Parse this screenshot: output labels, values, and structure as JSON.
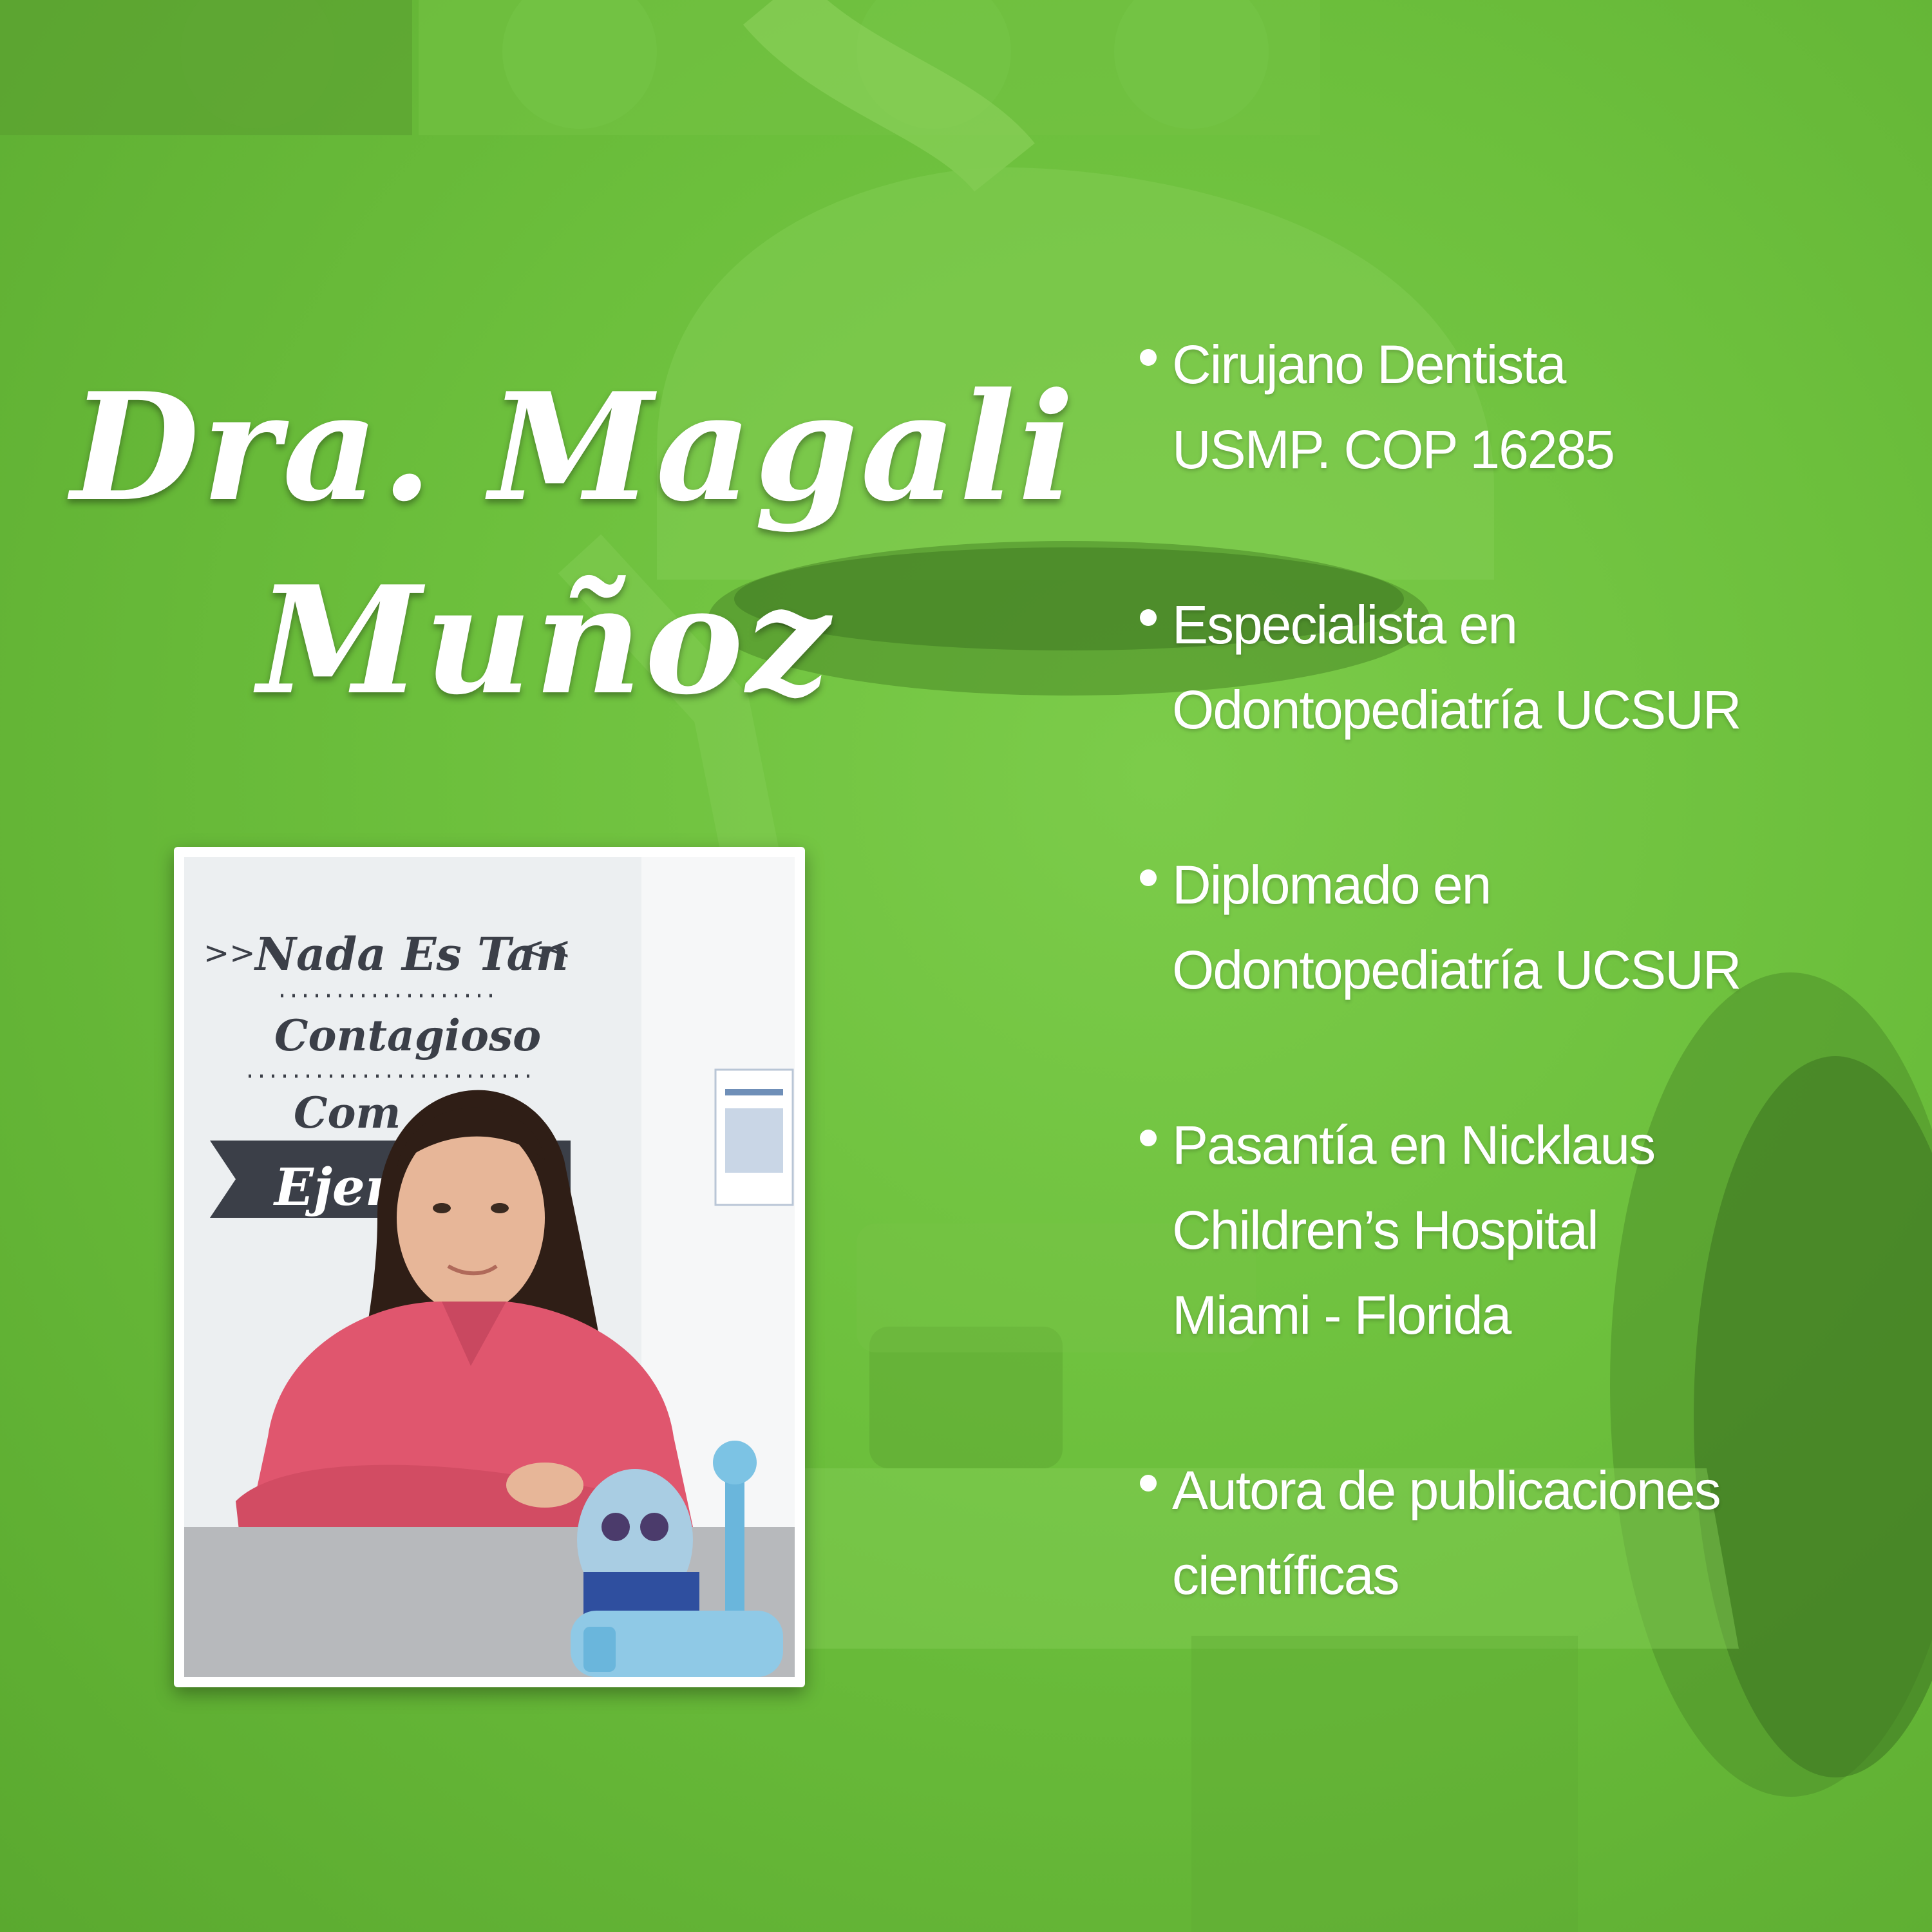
{
  "name": {
    "line1": "Dra. Magali",
    "line2": "Muñoz"
  },
  "photo": {
    "wall_text": {
      "line1": "Nada Es Tan",
      "line2": "Contagioso",
      "line3": "Com",
      "line4": "Ejem"
    }
  },
  "credentials": [
    {
      "lines": [
        "Cirujano Dentista",
        "USMP. COP 16285"
      ]
    },
    {
      "lines": [
        "Especialista en",
        "Odontopediatría UCSUR"
      ]
    },
    {
      "lines": [
        "Diplomado en",
        "Odontopediatría UCSUR"
      ]
    },
    {
      "lines": [
        "Pasantía en Nicklaus",
        "Children’s Hospital",
        "Miami - Florida"
      ]
    },
    {
      "lines": [
        "Autora de publicaciones",
        "científicas"
      ]
    }
  ],
  "colors": {
    "background": "#6cbf3c",
    "text": "#ffffff",
    "scrubs": "#e0566e"
  }
}
